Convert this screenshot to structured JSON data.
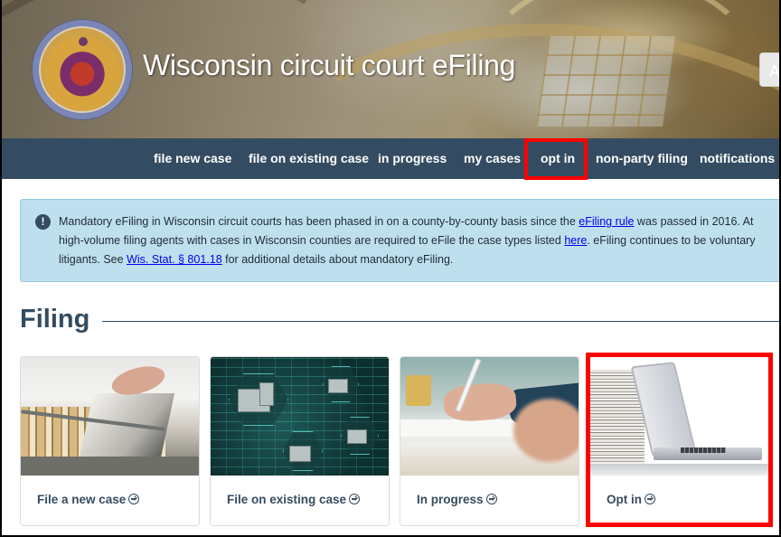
{
  "header": {
    "title": "Wisconsin circuit court eFiling",
    "seal_icon": "wisconsin-court-seal",
    "top_right_button_label": "A"
  },
  "nav": {
    "items": [
      {
        "label": "file new case"
      },
      {
        "label": "file on existing case"
      },
      {
        "label": "in progress"
      },
      {
        "label": "my cases"
      },
      {
        "label": "opt in",
        "highlighted": true
      },
      {
        "label": "non-party filing"
      },
      {
        "label": "notifications"
      }
    ],
    "background": "#344c61"
  },
  "alert": {
    "icon": "exclamation-circle-icon",
    "line1_prefix": "Mandatory eFiling in Wisconsin circuit courts has been phased in on a county-by-county basis since the ",
    "line1_link": "eFiling rule",
    "line1_suffix": " was passed in 2016. At",
    "line2_prefix": "high-volume filing agents with cases in Wisconsin counties are required to eFile the case types listed ",
    "line2_link": "here",
    "line2_suffix": ". eFiling continues to be voluntary",
    "line3_prefix": "litigants. See ",
    "line3_link": "Wis. Stat. § 801.18",
    "line3_suffix": " for additional details about mandatory eFiling.",
    "background": "#bee0ee"
  },
  "section": {
    "title": "Filing"
  },
  "cards": [
    {
      "label": "File a new case",
      "image": "filing-cabinet-photo"
    },
    {
      "label": "File on existing case",
      "image": "circuit-folders-graphic"
    },
    {
      "label": "In progress",
      "image": "hand-writing-photo"
    },
    {
      "label": "Opt in",
      "image": "laptop-papers-photo",
      "highlighted": true
    }
  ],
  "colors": {
    "primary": "#344c61",
    "highlight": "#ff0000",
    "link": "#0000ee"
  }
}
